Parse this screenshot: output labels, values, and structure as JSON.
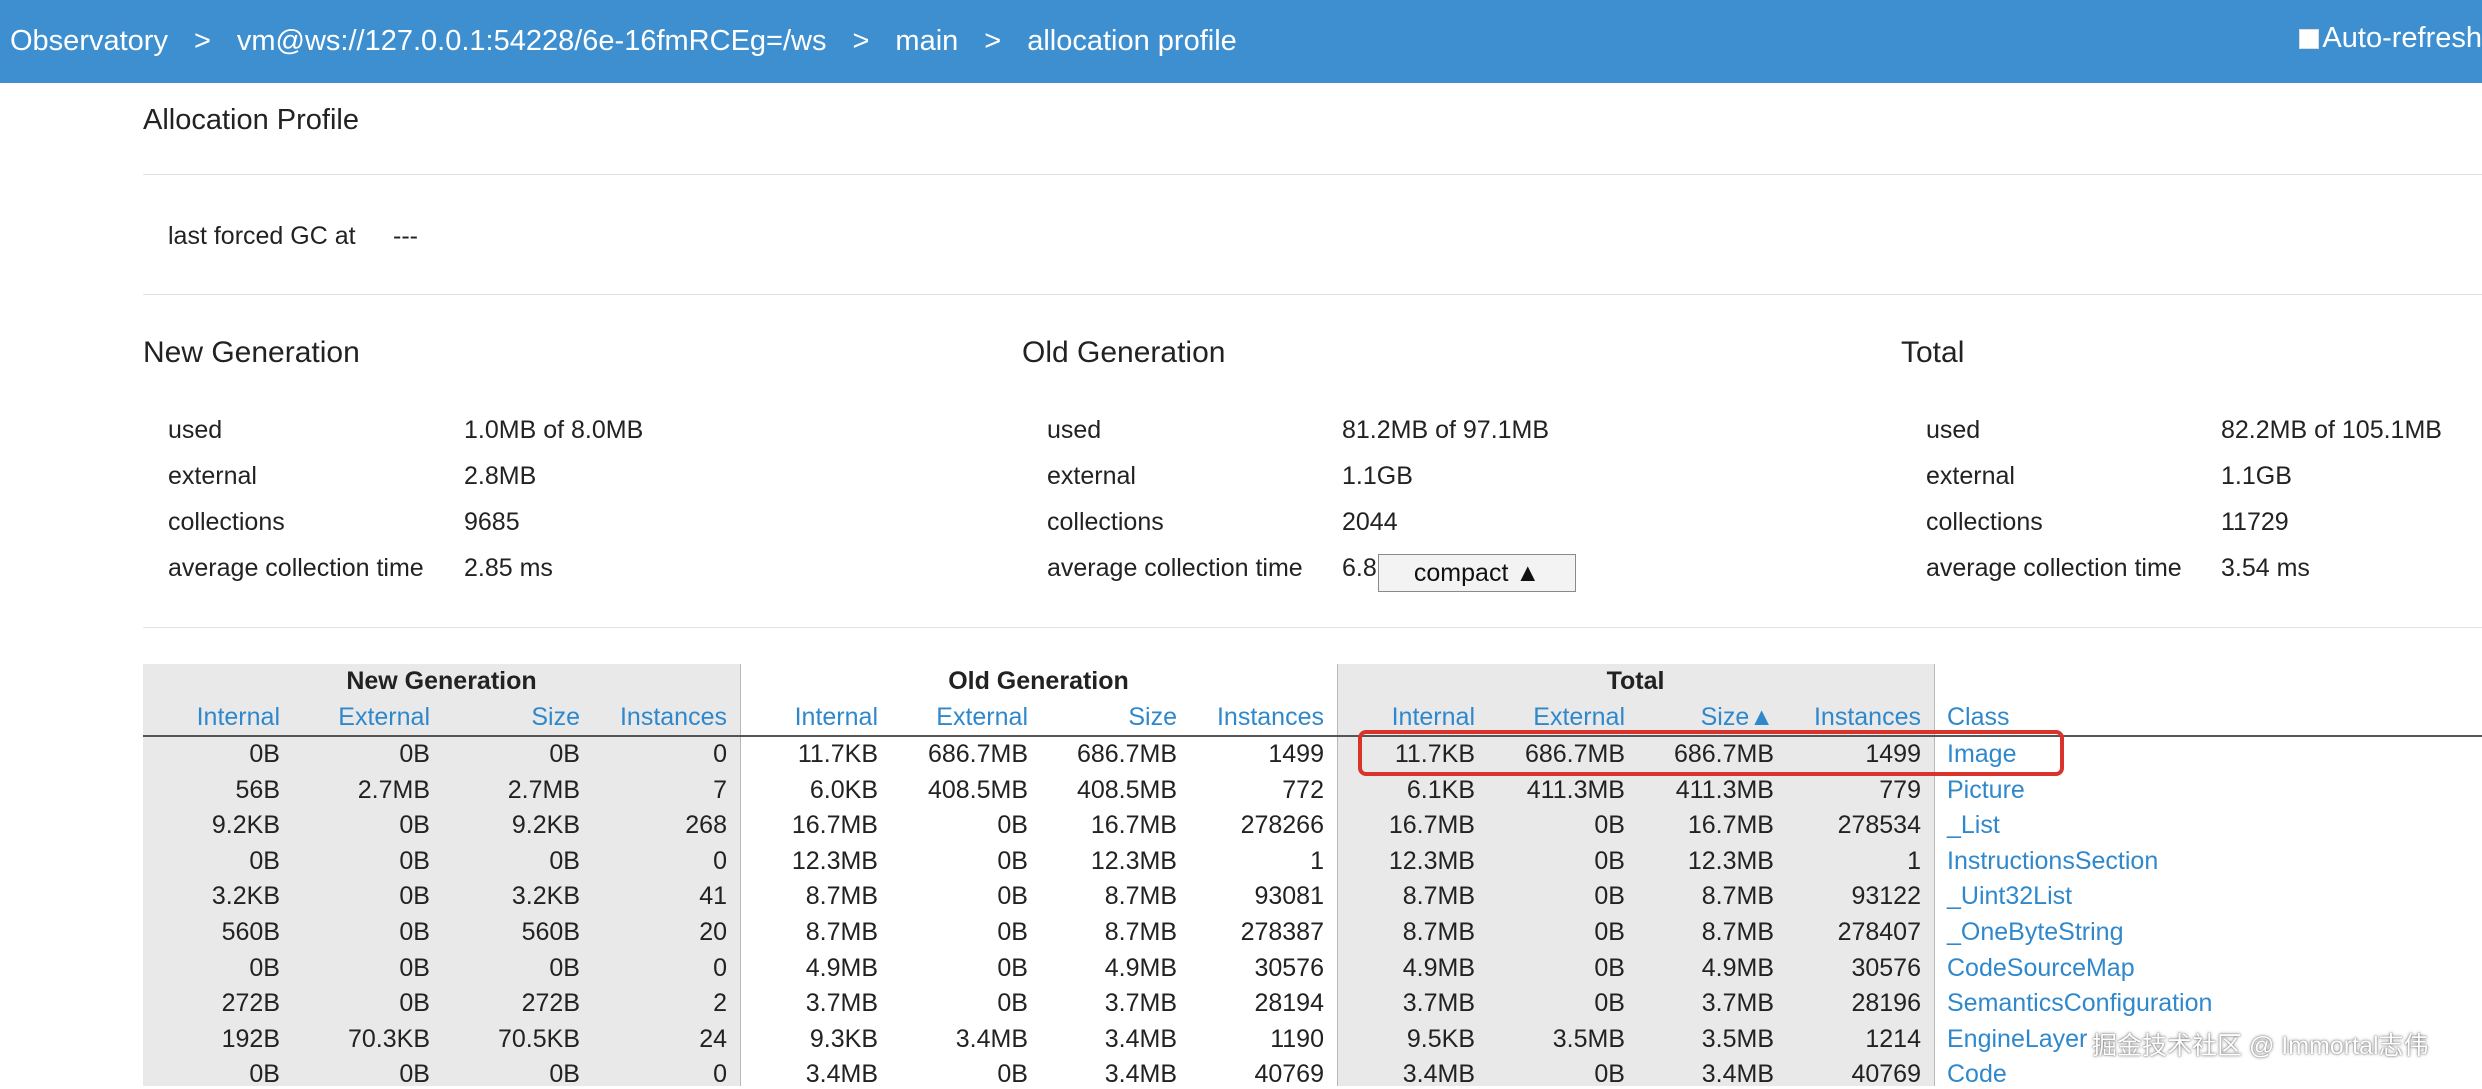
{
  "nav": {
    "breadcrumbs": [
      "Observatory",
      "vm@ws://127.0.0.1:54228/6e-16fmRCEg=/ws",
      "main",
      "allocation profile"
    ],
    "separator": ">",
    "auto_refresh_label": "Auto-refresh",
    "auto_refresh_checked": false
  },
  "page_title": "Allocation Profile",
  "gc": {
    "label": "last forced GC at",
    "value": "---"
  },
  "stats": [
    {
      "title": "New Generation",
      "rows": [
        {
          "label": "used",
          "value": "1.0MB of 8.0MB"
        },
        {
          "label": "external",
          "value": "2.8MB"
        },
        {
          "label": "collections",
          "value": "9685"
        },
        {
          "label": "average collection time",
          "value": "2.85 ms"
        }
      ]
    },
    {
      "title": "Old Generation",
      "rows": [
        {
          "label": "used",
          "value": "81.2MB of 97.1MB"
        },
        {
          "label": "external",
          "value": "1.1GB"
        },
        {
          "label": "collections",
          "value": "2044"
        },
        {
          "label": "average collection time",
          "value": "6.8"
        }
      ]
    },
    {
      "title": "Total",
      "rows": [
        {
          "label": "used",
          "value": "82.2MB of 105.1MB"
        },
        {
          "label": "external",
          "value": "1.1GB"
        },
        {
          "label": "collections",
          "value": "11729"
        },
        {
          "label": "average collection time",
          "value": "3.54 ms"
        }
      ]
    }
  ],
  "compact_button": "compact ▲",
  "table": {
    "groups": [
      "New Generation",
      "Old Generation",
      "Total"
    ],
    "columns": [
      "Internal",
      "External",
      "Size",
      "Instances",
      "Internal",
      "External",
      "Size",
      "Instances",
      "Internal",
      "External",
      "Size▲",
      "Instances",
      "Class"
    ],
    "rows": [
      {
        "cells": [
          "0B",
          "0B",
          "0B",
          "0",
          "11.7KB",
          "686.7MB",
          "686.7MB",
          "1499",
          "11.7KB",
          "686.7MB",
          "686.7MB",
          "1499"
        ],
        "class": "Image"
      },
      {
        "cells": [
          "56B",
          "2.7MB",
          "2.7MB",
          "7",
          "6.0KB",
          "408.5MB",
          "408.5MB",
          "772",
          "6.1KB",
          "411.3MB",
          "411.3MB",
          "779"
        ],
        "class": "Picture"
      },
      {
        "cells": [
          "9.2KB",
          "0B",
          "9.2KB",
          "268",
          "16.7MB",
          "0B",
          "16.7MB",
          "278266",
          "16.7MB",
          "0B",
          "16.7MB",
          "278534"
        ],
        "class": "_List"
      },
      {
        "cells": [
          "0B",
          "0B",
          "0B",
          "0",
          "12.3MB",
          "0B",
          "12.3MB",
          "1",
          "12.3MB",
          "0B",
          "12.3MB",
          "1"
        ],
        "class": "InstructionsSection"
      },
      {
        "cells": [
          "3.2KB",
          "0B",
          "3.2KB",
          "41",
          "8.7MB",
          "0B",
          "8.7MB",
          "93081",
          "8.7MB",
          "0B",
          "8.7MB",
          "93122"
        ],
        "class": "_Uint32List"
      },
      {
        "cells": [
          "560B",
          "0B",
          "560B",
          "20",
          "8.7MB",
          "0B",
          "8.7MB",
          "278387",
          "8.7MB",
          "0B",
          "8.7MB",
          "278407"
        ],
        "class": "_OneByteString"
      },
      {
        "cells": [
          "0B",
          "0B",
          "0B",
          "0",
          "4.9MB",
          "0B",
          "4.9MB",
          "30576",
          "4.9MB",
          "0B",
          "4.9MB",
          "30576"
        ],
        "class": "CodeSourceMap"
      },
      {
        "cells": [
          "272B",
          "0B",
          "272B",
          "2",
          "3.7MB",
          "0B",
          "3.7MB",
          "28194",
          "3.7MB",
          "0B",
          "3.7MB",
          "28196"
        ],
        "class": "SemanticsConfiguration"
      },
      {
        "cells": [
          "192B",
          "70.3KB",
          "70.5KB",
          "24",
          "9.3KB",
          "3.4MB",
          "3.4MB",
          "1190",
          "9.5KB",
          "3.5MB",
          "3.5MB",
          "1214"
        ],
        "class": "EngineLayer"
      },
      {
        "cells": [
          "0B",
          "0B",
          "0B",
          "0",
          "3.4MB",
          "0B",
          "3.4MB",
          "40769",
          "3.4MB",
          "0B",
          "3.4MB",
          "40769"
        ],
        "class": "Code"
      }
    ]
  },
  "watermark": "掘金技术社区 @ Immortal志伟",
  "colors": {
    "nav_bg": "#3e8fd0",
    "link": "#2f88cc",
    "highlight": "#d9342b",
    "group_bg": "#e9e9ea"
  }
}
